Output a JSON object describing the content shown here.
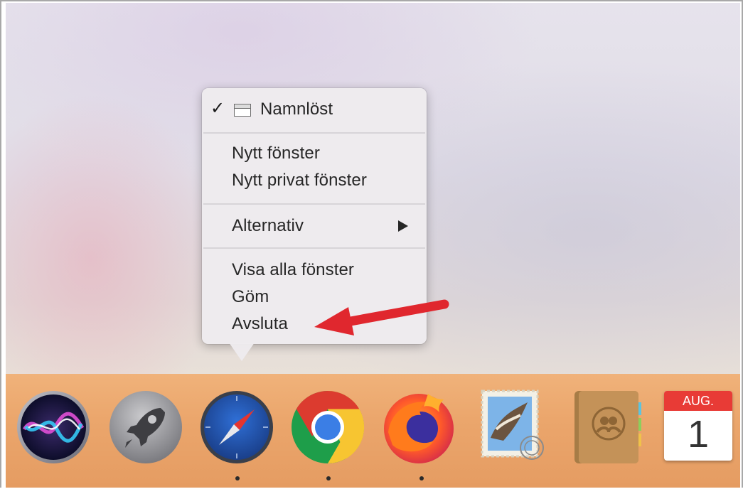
{
  "menu": {
    "window_item": "Namnlöst",
    "new_window": "Nytt fönster",
    "new_private_window": "Nytt privat fönster",
    "options": "Alternativ",
    "show_all_windows": "Visa alla fönster",
    "hide": "Göm",
    "quit": "Avsluta"
  },
  "dock": {
    "calendar_month": "AUG.",
    "calendar_day": "1",
    "running_apps": [
      "safari",
      "chrome",
      "firefox"
    ]
  },
  "colors": {
    "annotation_arrow": "#e0272e",
    "dock_background": "#eba66c"
  }
}
